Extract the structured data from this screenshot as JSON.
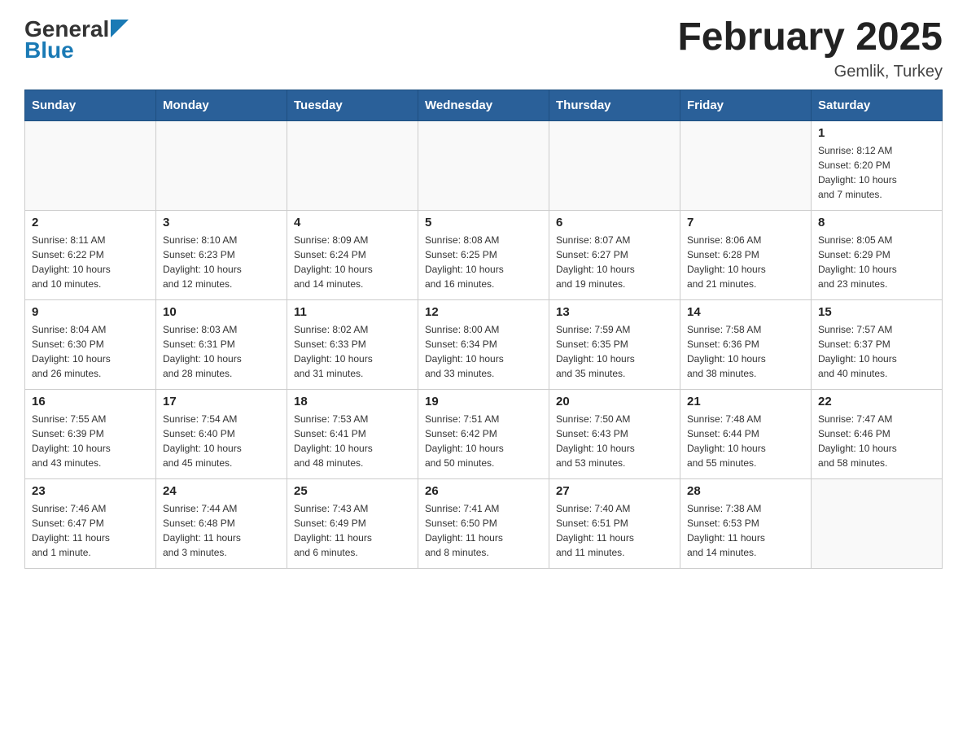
{
  "logo": {
    "general": "General",
    "blue": "Blue",
    "tagline": "GeneralBlue"
  },
  "title": "February 2025",
  "subtitle": "Gemlik, Turkey",
  "days": [
    "Sunday",
    "Monday",
    "Tuesday",
    "Wednesday",
    "Thursday",
    "Friday",
    "Saturday"
  ],
  "weeks": [
    [
      {
        "day": "",
        "info": ""
      },
      {
        "day": "",
        "info": ""
      },
      {
        "day": "",
        "info": ""
      },
      {
        "day": "",
        "info": ""
      },
      {
        "day": "",
        "info": ""
      },
      {
        "day": "",
        "info": ""
      },
      {
        "day": "1",
        "info": "Sunrise: 8:12 AM\nSunset: 6:20 PM\nDaylight: 10 hours\nand 7 minutes."
      }
    ],
    [
      {
        "day": "2",
        "info": "Sunrise: 8:11 AM\nSunset: 6:22 PM\nDaylight: 10 hours\nand 10 minutes."
      },
      {
        "day": "3",
        "info": "Sunrise: 8:10 AM\nSunset: 6:23 PM\nDaylight: 10 hours\nand 12 minutes."
      },
      {
        "day": "4",
        "info": "Sunrise: 8:09 AM\nSunset: 6:24 PM\nDaylight: 10 hours\nand 14 minutes."
      },
      {
        "day": "5",
        "info": "Sunrise: 8:08 AM\nSunset: 6:25 PM\nDaylight: 10 hours\nand 16 minutes."
      },
      {
        "day": "6",
        "info": "Sunrise: 8:07 AM\nSunset: 6:27 PM\nDaylight: 10 hours\nand 19 minutes."
      },
      {
        "day": "7",
        "info": "Sunrise: 8:06 AM\nSunset: 6:28 PM\nDaylight: 10 hours\nand 21 minutes."
      },
      {
        "day": "8",
        "info": "Sunrise: 8:05 AM\nSunset: 6:29 PM\nDaylight: 10 hours\nand 23 minutes."
      }
    ],
    [
      {
        "day": "9",
        "info": "Sunrise: 8:04 AM\nSunset: 6:30 PM\nDaylight: 10 hours\nand 26 minutes."
      },
      {
        "day": "10",
        "info": "Sunrise: 8:03 AM\nSunset: 6:31 PM\nDaylight: 10 hours\nand 28 minutes."
      },
      {
        "day": "11",
        "info": "Sunrise: 8:02 AM\nSunset: 6:33 PM\nDaylight: 10 hours\nand 31 minutes."
      },
      {
        "day": "12",
        "info": "Sunrise: 8:00 AM\nSunset: 6:34 PM\nDaylight: 10 hours\nand 33 minutes."
      },
      {
        "day": "13",
        "info": "Sunrise: 7:59 AM\nSunset: 6:35 PM\nDaylight: 10 hours\nand 35 minutes."
      },
      {
        "day": "14",
        "info": "Sunrise: 7:58 AM\nSunset: 6:36 PM\nDaylight: 10 hours\nand 38 minutes."
      },
      {
        "day": "15",
        "info": "Sunrise: 7:57 AM\nSunset: 6:37 PM\nDaylight: 10 hours\nand 40 minutes."
      }
    ],
    [
      {
        "day": "16",
        "info": "Sunrise: 7:55 AM\nSunset: 6:39 PM\nDaylight: 10 hours\nand 43 minutes."
      },
      {
        "day": "17",
        "info": "Sunrise: 7:54 AM\nSunset: 6:40 PM\nDaylight: 10 hours\nand 45 minutes."
      },
      {
        "day": "18",
        "info": "Sunrise: 7:53 AM\nSunset: 6:41 PM\nDaylight: 10 hours\nand 48 minutes."
      },
      {
        "day": "19",
        "info": "Sunrise: 7:51 AM\nSunset: 6:42 PM\nDaylight: 10 hours\nand 50 minutes."
      },
      {
        "day": "20",
        "info": "Sunrise: 7:50 AM\nSunset: 6:43 PM\nDaylight: 10 hours\nand 53 minutes."
      },
      {
        "day": "21",
        "info": "Sunrise: 7:48 AM\nSunset: 6:44 PM\nDaylight: 10 hours\nand 55 minutes."
      },
      {
        "day": "22",
        "info": "Sunrise: 7:47 AM\nSunset: 6:46 PM\nDaylight: 10 hours\nand 58 minutes."
      }
    ],
    [
      {
        "day": "23",
        "info": "Sunrise: 7:46 AM\nSunset: 6:47 PM\nDaylight: 11 hours\nand 1 minute."
      },
      {
        "day": "24",
        "info": "Sunrise: 7:44 AM\nSunset: 6:48 PM\nDaylight: 11 hours\nand 3 minutes."
      },
      {
        "day": "25",
        "info": "Sunrise: 7:43 AM\nSunset: 6:49 PM\nDaylight: 11 hours\nand 6 minutes."
      },
      {
        "day": "26",
        "info": "Sunrise: 7:41 AM\nSunset: 6:50 PM\nDaylight: 11 hours\nand 8 minutes."
      },
      {
        "day": "27",
        "info": "Sunrise: 7:40 AM\nSunset: 6:51 PM\nDaylight: 11 hours\nand 11 minutes."
      },
      {
        "day": "28",
        "info": "Sunrise: 7:38 AM\nSunset: 6:53 PM\nDaylight: 11 hours\nand 14 minutes."
      },
      {
        "day": "",
        "info": ""
      }
    ]
  ]
}
